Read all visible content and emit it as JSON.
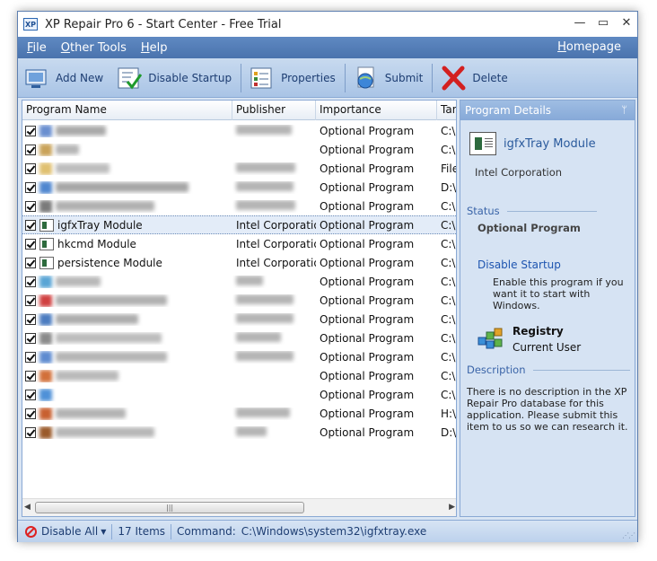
{
  "window": {
    "title": "XP Repair Pro 6 - Start Center - Free Trial",
    "app_icon_text": "XP",
    "controls": {
      "minimize": "✕",
      "min_glyph": "—",
      "max_glyph": "▭",
      "close_glyph": "✕"
    }
  },
  "menu": {
    "items": [
      {
        "label": "File",
        "accel": "F",
        "rest": "ile"
      },
      {
        "label": "Other Tools",
        "accel": "O",
        "rest": "ther Tools"
      },
      {
        "label": "Help",
        "accel": "H",
        "rest": "elp"
      }
    ],
    "homepage": {
      "accel": "H",
      "rest": "omepage"
    }
  },
  "toolbar": {
    "add_new": "Add New",
    "disable_startup": "Disable Startup",
    "properties": "Properties",
    "submit": "Submit",
    "delete": "Delete"
  },
  "list": {
    "columns": [
      "Program Name",
      "Publisher",
      "Importance",
      "Targ"
    ],
    "rows": [
      {
        "name": "",
        "publisher": "",
        "importance": "Optional Program",
        "target": "C:\\P",
        "blurred": true,
        "checked": true
      },
      {
        "name": "",
        "publisher": "",
        "importance": "Optional Program",
        "target": "C:\\P",
        "blurred": true,
        "checked": true
      },
      {
        "name": "",
        "publisher": "",
        "importance": "Optional Program",
        "target": "File",
        "blurred": true,
        "checked": true
      },
      {
        "name": "",
        "publisher": "",
        "importance": "Optional Program",
        "target": "D:\\A",
        "blurred": true,
        "checked": true
      },
      {
        "name": "",
        "publisher": "",
        "importance": "Optional Program",
        "target": "C:\\P",
        "blurred": true,
        "checked": true
      },
      {
        "name": "igfxTray Module",
        "publisher": "Intel Corporation",
        "importance": "Optional Program",
        "target": "C:\\W",
        "blurred": false,
        "checked": true,
        "selected": true
      },
      {
        "name": "hkcmd Module",
        "publisher": "Intel Corporation",
        "importance": "Optional Program",
        "target": "C:\\W",
        "blurred": false,
        "checked": true
      },
      {
        "name": "persistence Module",
        "publisher": "Intel Corporation",
        "importance": "Optional Program",
        "target": "C:\\W",
        "blurred": false,
        "checked": true
      },
      {
        "name": "",
        "publisher": "",
        "importance": "Optional Program",
        "target": "C:\\P",
        "blurred": true,
        "checked": true
      },
      {
        "name": "",
        "publisher": "",
        "importance": "Optional Program",
        "target": "C:\\P",
        "blurred": true,
        "checked": true
      },
      {
        "name": "",
        "publisher": "",
        "importance": "Optional Program",
        "target": "C:\\P",
        "blurred": true,
        "checked": true
      },
      {
        "name": "",
        "publisher": "",
        "importance": "Optional Program",
        "target": "C:\\P",
        "blurred": true,
        "checked": true
      },
      {
        "name": "",
        "publisher": "",
        "importance": "Optional Program",
        "target": "C:\\P",
        "blurred": true,
        "checked": true
      },
      {
        "name": "",
        "publisher": "",
        "importance": "Optional Program",
        "target": "C:\\P",
        "blurred": true,
        "checked": true
      },
      {
        "name": "",
        "publisher": "",
        "importance": "Optional Program",
        "target": "C:\\P",
        "blurred": true,
        "checked": true
      },
      {
        "name": "",
        "publisher": "",
        "importance": "Optional Program",
        "target": "H:\\to",
        "blurred": true,
        "checked": true
      },
      {
        "name": "",
        "publisher": "",
        "importance": "Optional Program",
        "target": "D:\\V",
        "blurred": true,
        "checked": true
      }
    ]
  },
  "details": {
    "header": "Program Details",
    "pin_glyph": "ᛘ",
    "program_name": "igfxTray Module",
    "publisher": "Intel Corporation",
    "status_label": "Status",
    "status_value": "Optional Program",
    "action_link": "Disable Startup",
    "action_desc": "Enable this program if you want it to start with Windows.",
    "registry_title": "Registry",
    "registry_sub": "Current User",
    "description_label": "Description",
    "description_text": "There is no description in the XP Repair Pro database for this application.  Please submit this item to us so we can research it."
  },
  "statusbar": {
    "disable_all": "Disable All",
    "items_count": "17 Items",
    "command_label": "Command:",
    "command_value": "C:\\Windows\\system32\\igfxtray.exe"
  },
  "colors": {
    "menubar": "#4a73ad",
    "toolbar": "#b8cfeb",
    "accent_link": "#1e55b0"
  }
}
